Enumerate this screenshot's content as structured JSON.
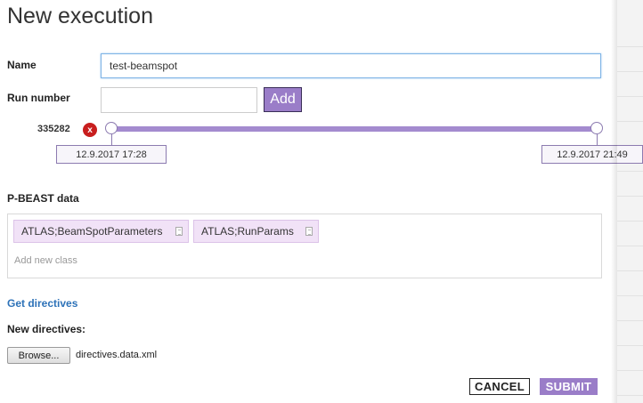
{
  "dialog": {
    "title": "New execution"
  },
  "name_field": {
    "label": "Name",
    "value": "test-beamspot"
  },
  "run_number": {
    "label": "Run number",
    "value": "",
    "add_label": "Add"
  },
  "run_range": {
    "run": "335282",
    "remove_label": "x",
    "start_time": "12.9.2017 17:28",
    "end_time": "12.9.2017 21:49"
  },
  "pbeast": {
    "label": "P-BEAST data",
    "classes": [
      "ATLAS;BeamSpotParameters",
      "ATLAS;RunParams"
    ],
    "add_placeholder": "Add new class"
  },
  "directives": {
    "get_link": "Get directives",
    "new_label": "New directives:",
    "browse_label": "Browse...",
    "file_name": "directives.data.xml"
  },
  "actions": {
    "cancel": "CANCEL",
    "submit": "SUBMIT"
  },
  "colors": {
    "accent": "#9a7dc8",
    "link": "#2d72b8",
    "tag_bg": "#f1e2f7",
    "remove": "#c81e1e"
  }
}
